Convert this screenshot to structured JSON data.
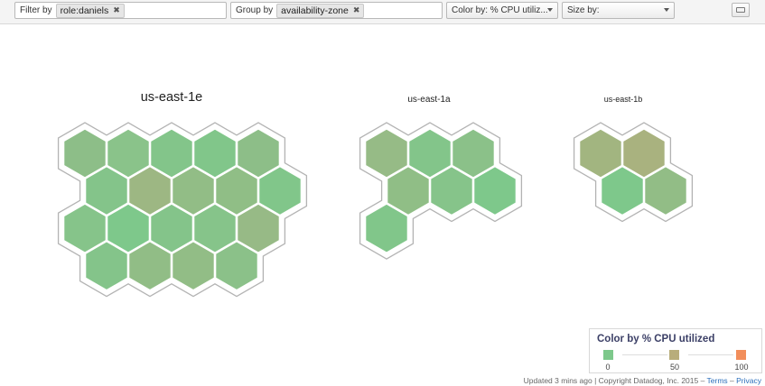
{
  "toolbar": {
    "filter_label": "Filter by",
    "filter_tag": "role:daniels",
    "group_label": "Group by",
    "group_tag": "availability-zone",
    "tag_remove_icon": "close-icon",
    "color_select": "Color by: % CPU utiliz...",
    "size_select": "Size by:",
    "keyboard_icon": "keyboard-icon"
  },
  "groups": [
    {
      "name": "us-east-1e",
      "rows": [
        [
          "#8dbe88",
          "#8ac38a",
          "#83c58a",
          "#81c68a",
          "#8dbe88"
        ],
        [
          "#84c48a",
          "#9db783",
          "#92bd86",
          "#90be86",
          "#81c68a"
        ],
        [
          "#86c48a",
          "#7ec88b",
          "#84c48a",
          "#86c48a",
          "#97ba86"
        ],
        [
          "#84c48a",
          "#91bd86",
          "#92bd86",
          "#8bc189"
        ]
      ]
    },
    {
      "name": "us-east-1a",
      "rows": [
        [
          "#96bb86",
          "#83c58a",
          "#8bc189"
        ],
        [
          "#90be86",
          "#86c48a",
          "#7ec88b"
        ],
        [
          "#81c68a"
        ]
      ]
    },
    {
      "name": "us-east-1b",
      "rows": [
        [
          "#a2b580",
          "#a9b27f"
        ],
        [
          "#7ec88b",
          "#92bd86"
        ]
      ]
    }
  ],
  "legend": {
    "title": "Color by % CPU utilized",
    "stops": [
      {
        "label": "0",
        "color": "#7dc88b"
      },
      {
        "label": "50",
        "color": "#b8ad7b"
      },
      {
        "label": "100",
        "color": "#f28e5b"
      }
    ]
  },
  "footer": {
    "updated": "Updated 3 mins ago",
    "sep1": " | ",
    "copyright": "Copyright Datadog, Inc. 2015",
    "sep2": " – ",
    "terms": "Terms",
    "sep3": " – ",
    "privacy": "Privacy"
  }
}
